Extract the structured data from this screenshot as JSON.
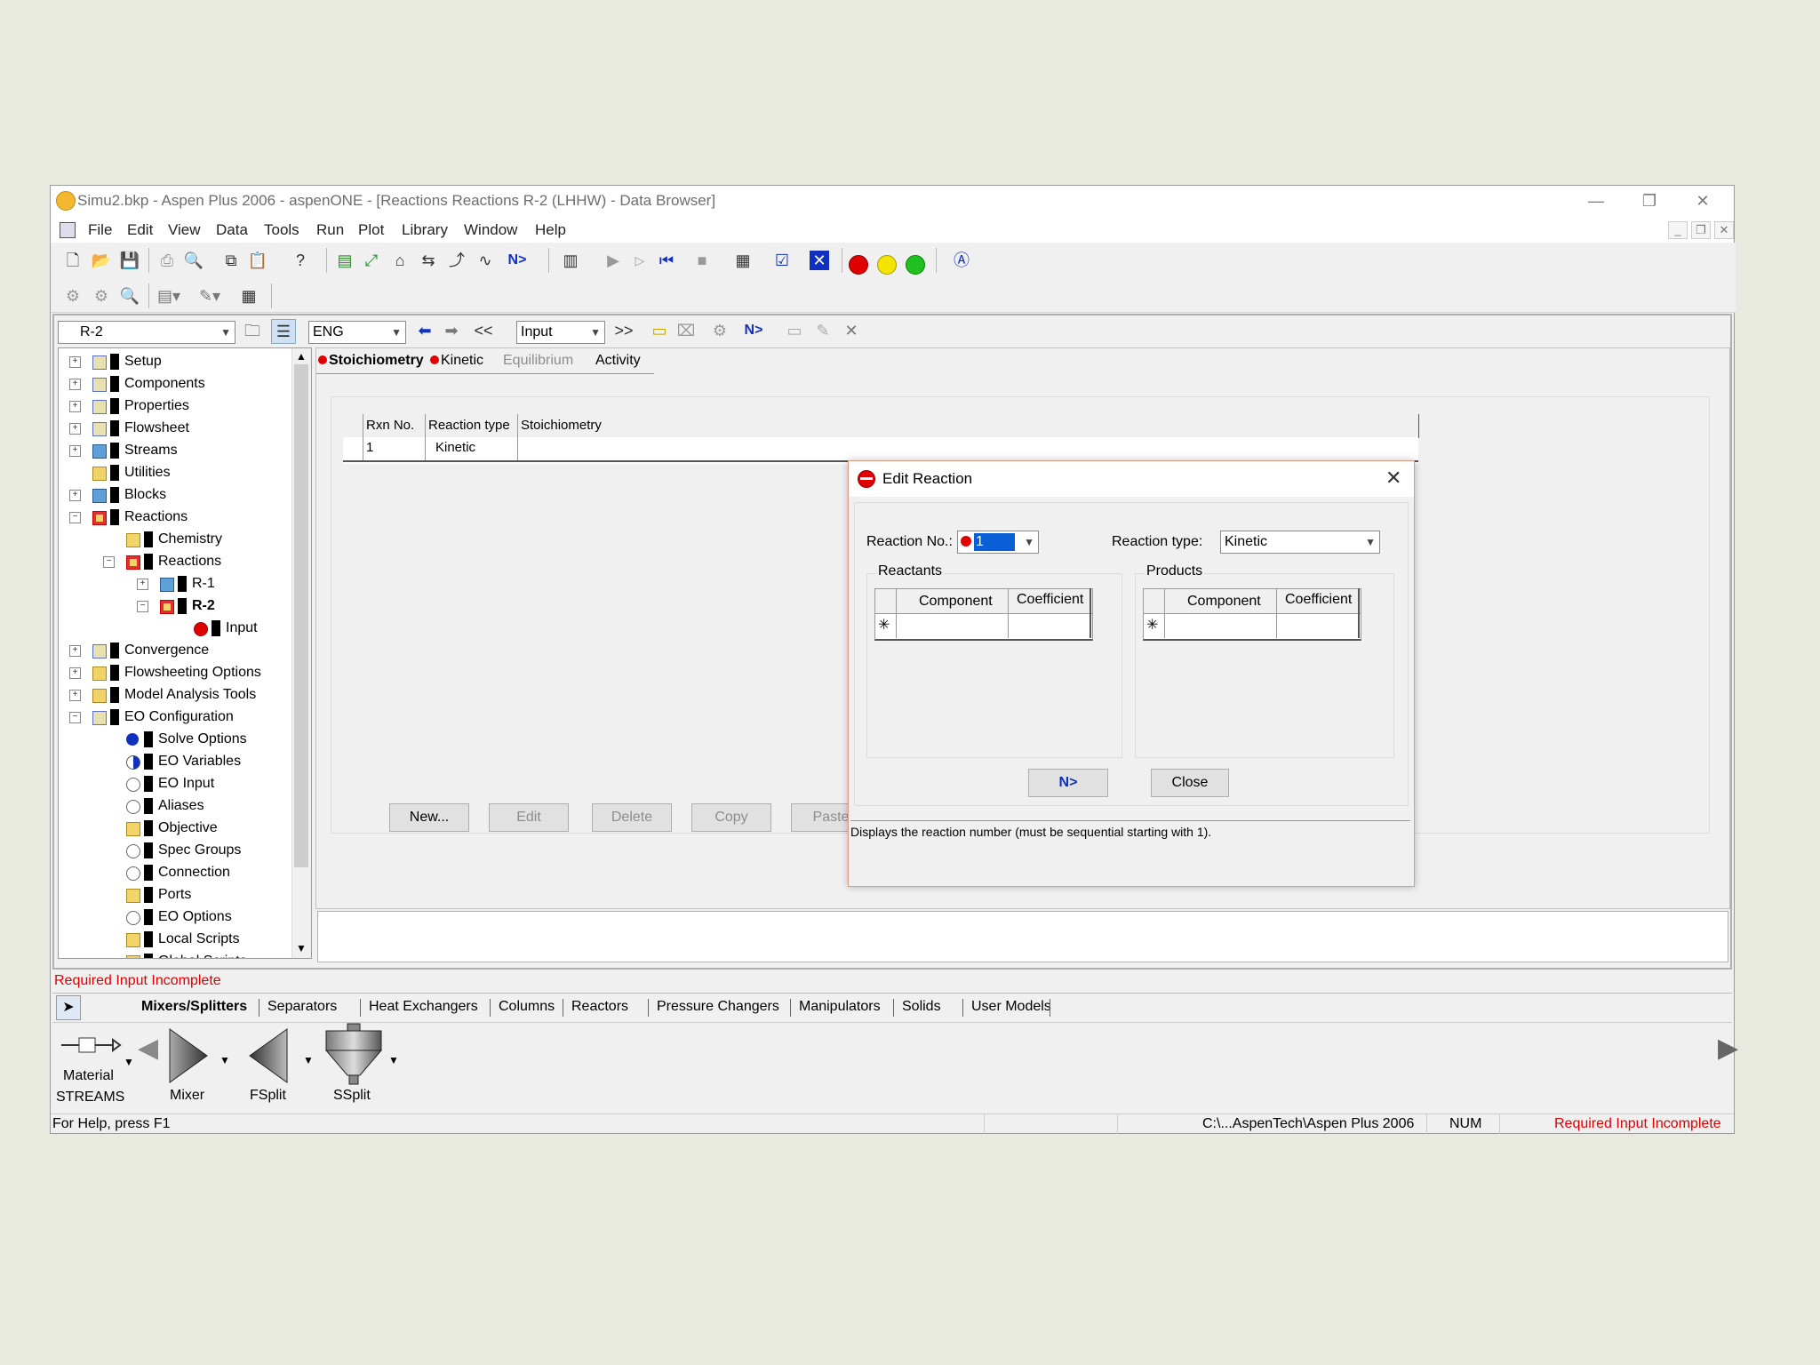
{
  "window": {
    "title": "Simu2.bkp - Aspen Plus 2006 - aspenONE - [Reactions Reactions R-2 (LHHW) - Data Browser]",
    "minimize": "—",
    "restore": "❐",
    "close": "✕"
  },
  "menu": [
    "File",
    "Edit",
    "View",
    "Data",
    "Tools",
    "Run",
    "Plot",
    "Library",
    "Window",
    "Help"
  ],
  "browser": {
    "object_combo": "R-2",
    "units_combo": "ENG",
    "prev": "<<",
    "view_combo": "Input",
    "next": ">>",
    "next_label": "N>"
  },
  "tree": [
    {
      "label": "Setup",
      "level": 0,
      "pm": "+",
      "icon": "check"
    },
    {
      "label": "Components",
      "level": 0,
      "pm": "+",
      "icon": "check"
    },
    {
      "label": "Properties",
      "level": 0,
      "pm": "+",
      "icon": "check"
    },
    {
      "label": "Flowsheet",
      "level": 0,
      "pm": "+",
      "icon": "check"
    },
    {
      "label": "Streams",
      "level": 0,
      "pm": "+",
      "icon": "blue"
    },
    {
      "label": "Utilities",
      "level": 0,
      "pm": "",
      "icon": "folder"
    },
    {
      "label": "Blocks",
      "level": 0,
      "pm": "+",
      "icon": "blue"
    },
    {
      "label": "Reactions",
      "level": 0,
      "pm": "-",
      "icon": "red"
    },
    {
      "label": "Chemistry",
      "level": 1,
      "pm": "",
      "icon": "folder"
    },
    {
      "label": "Reactions",
      "level": 1,
      "pm": "-",
      "icon": "red"
    },
    {
      "label": "R-1",
      "level": 2,
      "pm": "+",
      "icon": "blue"
    },
    {
      "label": "R-2",
      "level": 2,
      "pm": "-",
      "icon": "red",
      "bold": true
    },
    {
      "label": "Input",
      "level": 3,
      "pm": "",
      "icon": "redcircle"
    },
    {
      "label": "Convergence",
      "level": 0,
      "pm": "+",
      "icon": "check"
    },
    {
      "label": "Flowsheeting Options",
      "level": 0,
      "pm": "+",
      "icon": "folder"
    },
    {
      "label": "Model Analysis Tools",
      "level": 0,
      "pm": "+",
      "icon": "folder"
    },
    {
      "label": "EO Configuration",
      "level": 0,
      "pm": "-",
      "icon": "check"
    },
    {
      "label": "Solve Options",
      "level": 1,
      "pm": "",
      "icon": "bluecheck"
    },
    {
      "label": "EO Variables",
      "level": 1,
      "pm": "",
      "icon": "halfblue"
    },
    {
      "label": "EO Input",
      "level": 1,
      "pm": "",
      "icon": "empty"
    },
    {
      "label": "Aliases",
      "level": 1,
      "pm": "",
      "icon": "empty"
    },
    {
      "label": "Objective",
      "level": 1,
      "pm": "",
      "icon": "folder"
    },
    {
      "label": "Spec Groups",
      "level": 1,
      "pm": "",
      "icon": "empty"
    },
    {
      "label": "Connection",
      "level": 1,
      "pm": "",
      "icon": "empty"
    },
    {
      "label": "Ports",
      "level": 1,
      "pm": "",
      "icon": "folder"
    },
    {
      "label": "EO Options",
      "level": 1,
      "pm": "",
      "icon": "empty"
    },
    {
      "label": "Local Scripts",
      "level": 1,
      "pm": "",
      "icon": "folder"
    },
    {
      "label": "Global Scripts",
      "level": 1,
      "pm": "",
      "icon": "folder"
    }
  ],
  "tabs": [
    "Stoichiometry",
    "Kinetic",
    "Equilibrium",
    "Activity"
  ],
  "grid": {
    "headers": [
      "Rxn No.",
      "Reaction type",
      "Stoichiometry"
    ],
    "row": [
      "1",
      "Kinetic",
      ""
    ]
  },
  "form_buttons": [
    "New...",
    "Edit",
    "Delete",
    "Copy",
    "Paste"
  ],
  "dialog": {
    "title": "Edit Reaction",
    "rxn_no_label": "Reaction No.:",
    "rxn_no_value": "1",
    "rxn_type_label": "Reaction type:",
    "rxn_type_value": "Kinetic",
    "reactants_label": "Reactants",
    "products_label": "Products",
    "col_component": "Component",
    "col_coefficient": "Coefficient",
    "new_row_marker": "✳",
    "next_button": "N>",
    "close_button": "Close",
    "prompt": "Displays the reaction number (must be sequential starting with 1)."
  },
  "status_left": "Required Input Incomplete",
  "palette": {
    "tabs": [
      "Mixers/Splitters",
      "Separators",
      "Heat Exchangers",
      "Columns",
      "Reactors",
      "Pressure Changers",
      "Manipulators",
      "Solids",
      "User Models"
    ],
    "material_label": "Material",
    "streams_label": "STREAMS",
    "models": [
      "Mixer",
      "FSplit",
      "SSplit"
    ]
  },
  "statusbar": {
    "help": "For Help, press F1",
    "path": "C:\\...AspenTech\\Aspen Plus 2006",
    "num": "NUM",
    "state": "Required Input Incomplete"
  },
  "colors": {
    "required": "#e00000",
    "link_blue": "#1030c0"
  }
}
